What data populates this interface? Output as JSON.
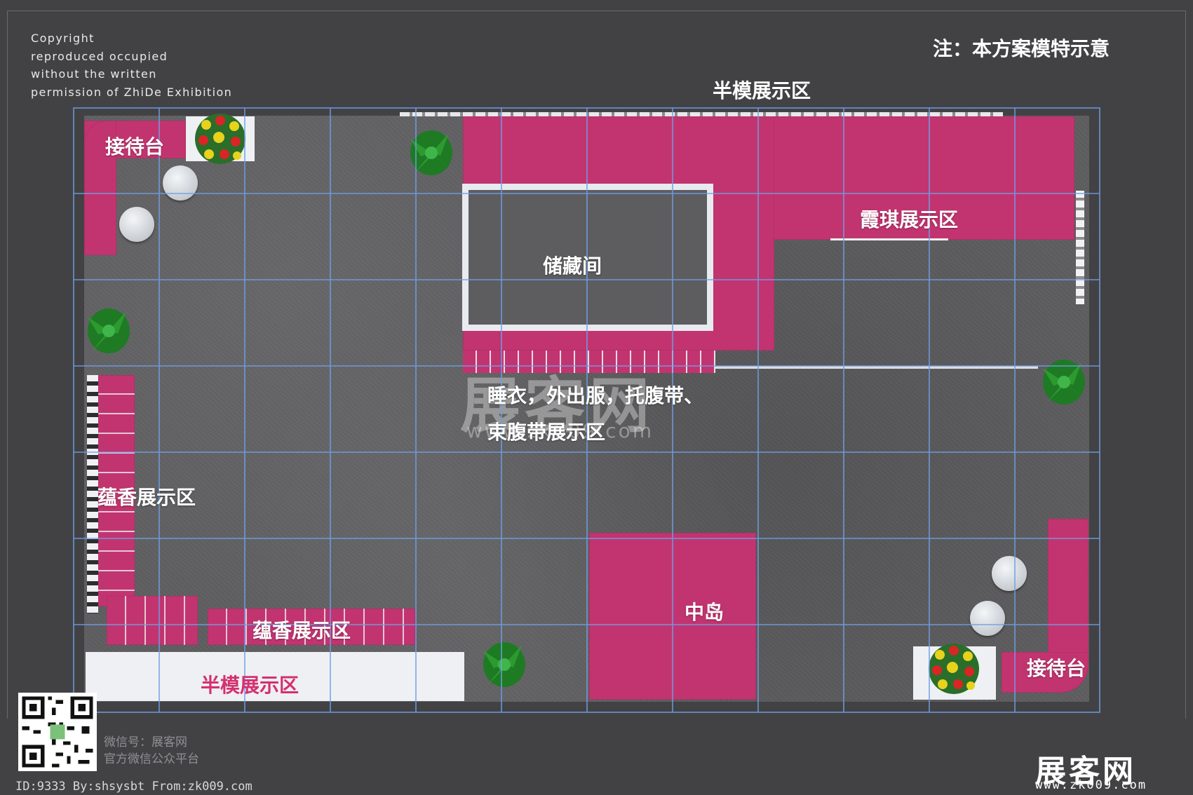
{
  "copyright": {
    "lines": [
      "Copyright",
      "reproduced occupied",
      "without the written",
      "permission of ZhiDe Exhibition"
    ]
  },
  "note": "注：本方案模特示意",
  "top_title": "半模展示区",
  "labels": {
    "reception_top_left": "接待台",
    "storage": "储藏间",
    "xiaqi": "霞琪展示区",
    "sleepwear_line1": "睡衣，外出服，托腹带、",
    "sleepwear_line2": "束腹带展示区",
    "yunxiang_left": "蕴香展示区",
    "yunxiang_bottom": "蕴香展示区",
    "half_model_bottom": "半模展示区",
    "middle_island": "中岛",
    "reception_bottom_right": "接待台"
  },
  "watermark": {
    "logo": "展客网",
    "url": "www.zk009.com"
  },
  "footer": {
    "wechat_line1": "微信号：展客网",
    "wechat_line2": "官方微信公众平台",
    "id_line": "ID:9333 By:shsysbt From:zk009.com",
    "brand_logo": "展客网",
    "brand_url": "www.zk009.com"
  },
  "colors": {
    "background": "#424244",
    "carpet": "#5e5e60",
    "booth_magenta": "#c23470",
    "grid_line": "#6f9fe6",
    "white_panel": "#eef0f4"
  }
}
